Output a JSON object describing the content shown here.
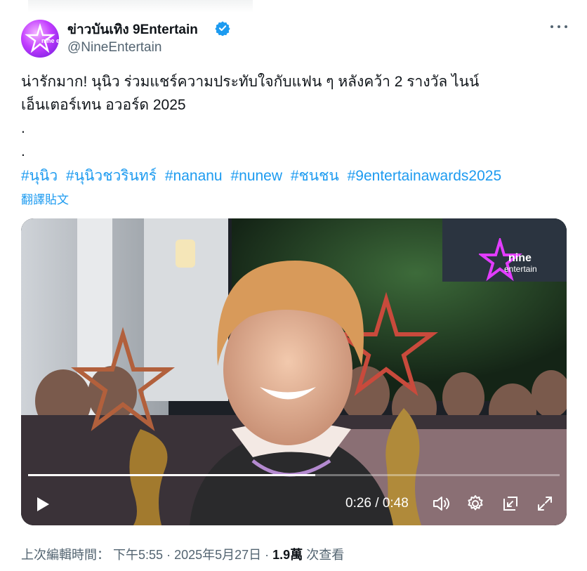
{
  "author": {
    "display_name": "ข่าวบันเทิง 9Entertain",
    "handle": "@NineEntertain",
    "verified": true,
    "avatar_text": "nine entertain"
  },
  "menu": {
    "more_icon": "more-horizontal-icon"
  },
  "tweet": {
    "lines": [
      "น่ารักมาก! นุนิว ร่วมแชร์ความประทับใจกับแฟน ๆ หลังคว้า 2 รางวัล ไนน์",
      "เอ็นเตอร์เทน อวอร์ด 2025",
      ".",
      "."
    ],
    "hashtags": [
      "#นุนิว",
      "#นุนิวชวรินทร์",
      "#nananu",
      "#nunew",
      "#ชนชน",
      "#9entertainawards2025"
    ],
    "translate_label": "翻譯貼文"
  },
  "video": {
    "watermark_line1": "nine",
    "watermark_line2": "entertain",
    "current_time": "0:26",
    "duration": "0:48",
    "time_display": "0:26 / 0:48",
    "progress": 0.54,
    "controls": [
      "play-icon",
      "volume-icon",
      "settings-icon",
      "picture-in-picture-icon",
      "fullscreen-icon"
    ]
  },
  "footer": {
    "edited_label": "上次編輯時間：",
    "time": "下午5:55",
    "date": "2025年5月27日",
    "views_count": "1.9萬",
    "views_label": "次查看"
  },
  "colors": {
    "link": "#1d9bf0",
    "secondary": "#536471",
    "text": "#0f1419"
  }
}
